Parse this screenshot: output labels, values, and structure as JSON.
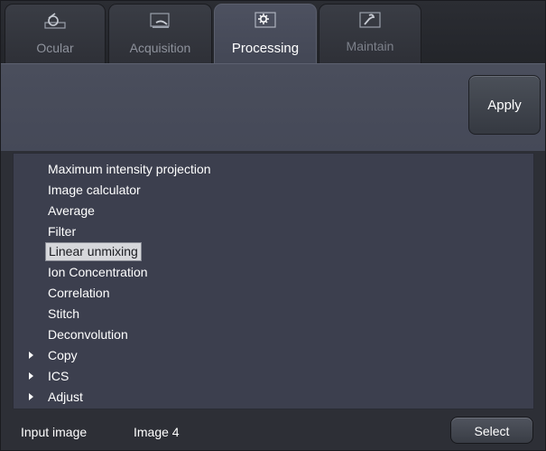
{
  "tabs": [
    {
      "label": "Ocular",
      "icon": "eye-icon",
      "active": false
    },
    {
      "label": "Acquisition",
      "icon": "acquisition-icon",
      "active": false
    },
    {
      "label": "Processing",
      "icon": "gear-icon",
      "active": true
    },
    {
      "label": "Maintain",
      "icon": "wrench-icon",
      "active": false
    }
  ],
  "toolbar": {
    "apply_label": "Apply"
  },
  "methods": [
    {
      "label": "Maximum intensity projection",
      "selected": false,
      "group": false
    },
    {
      "label": "Image calculator",
      "selected": false,
      "group": false
    },
    {
      "label": "Average",
      "selected": false,
      "group": false
    },
    {
      "label": "Filter",
      "selected": false,
      "group": false
    },
    {
      "label": "Linear unmixing",
      "selected": true,
      "group": false
    },
    {
      "label": "Ion Concentration",
      "selected": false,
      "group": false
    },
    {
      "label": "Correlation",
      "selected": false,
      "group": false
    },
    {
      "label": "Stitch",
      "selected": false,
      "group": false
    },
    {
      "label": "Deconvolution",
      "selected": false,
      "group": false
    },
    {
      "label": "Copy",
      "selected": false,
      "group": true
    },
    {
      "label": "ICS",
      "selected": false,
      "group": true
    },
    {
      "label": "Adjust",
      "selected": false,
      "group": true
    }
  ],
  "input": {
    "label": "Input image",
    "value": "Image 4",
    "select_label": "Select"
  },
  "colors": {
    "background": "#2d2f36",
    "active_tab": "#4a4e5c",
    "list_background": "#3c3f4e",
    "selection": "#d6d7db"
  }
}
